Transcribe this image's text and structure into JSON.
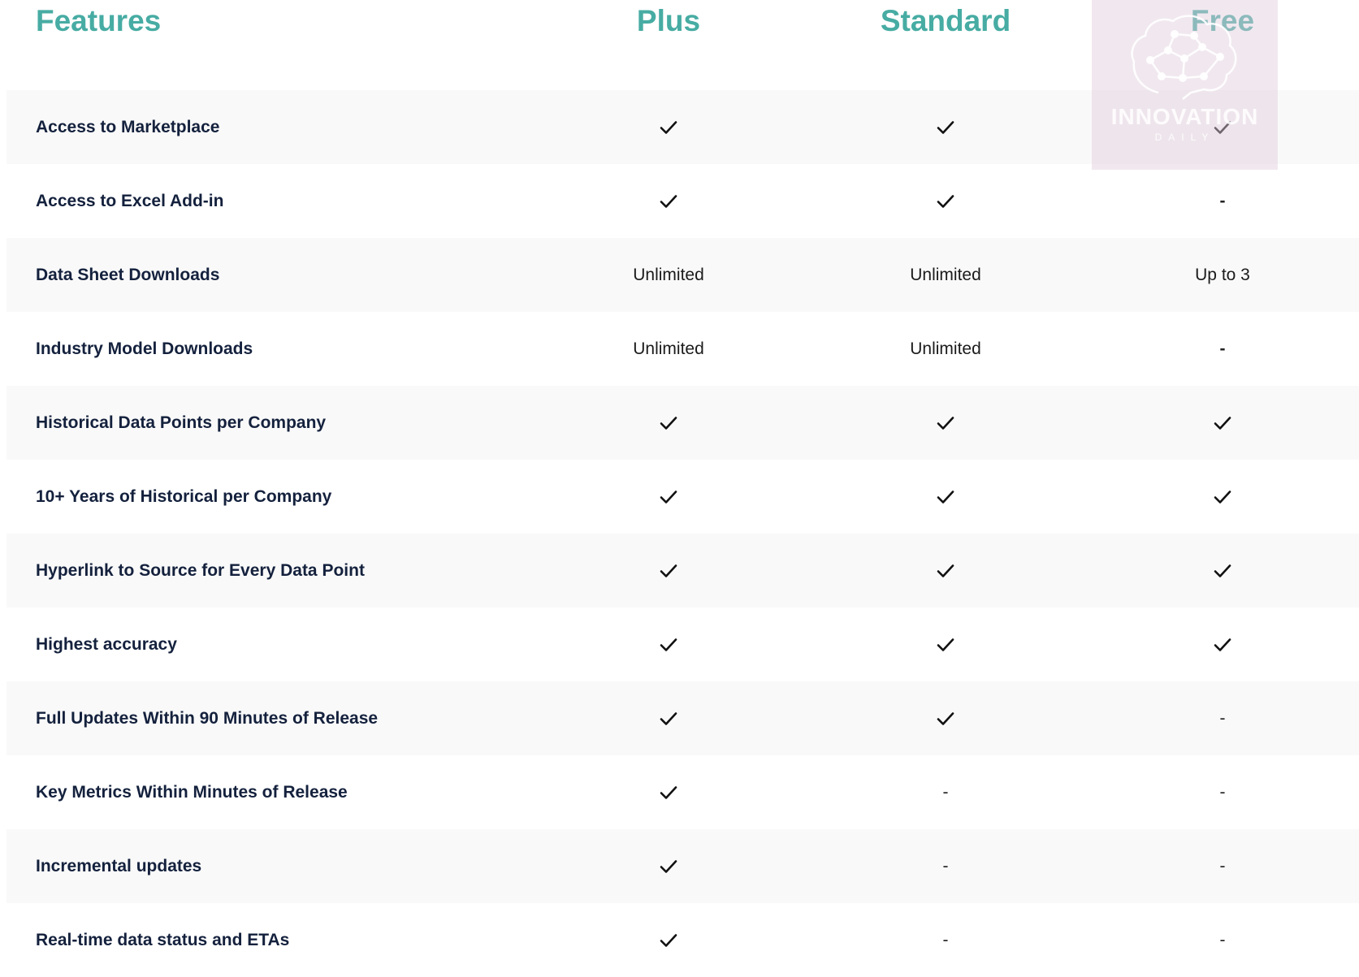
{
  "header": {
    "features_title": "Features",
    "plans": [
      "Plus",
      "Standard",
      "Free"
    ]
  },
  "rows": [
    {
      "feature": "Access to Marketplace",
      "plus": "check",
      "standard": "check",
      "free": "check"
    },
    {
      "feature": "Access to Excel Add-in",
      "plus": "check",
      "standard": "check",
      "free": "-"
    },
    {
      "feature": "Data Sheet Downloads",
      "plus": "Unlimited",
      "standard": "Unlimited",
      "free": "Up to 3"
    },
    {
      "feature": "Industry Model Downloads",
      "plus": "Unlimited",
      "standard": "Unlimited",
      "free": "-"
    },
    {
      "feature": "Historical Data Points per Company",
      "plus": "check",
      "standard": "check",
      "free": "check"
    },
    {
      "feature": "10+ Years of Historical per Company",
      "plus": "check",
      "standard": "check",
      "free": "check"
    },
    {
      "feature": "Hyperlink to Source for Every Data Point",
      "plus": "check",
      "standard": "check",
      "free": "check"
    },
    {
      "feature": "Highest accuracy",
      "plus": "check",
      "standard": "check",
      "free": "check"
    },
    {
      "feature": "Full Updates Within 90 Minutes of Release",
      "plus": "check",
      "standard": "check",
      "free": "-"
    },
    {
      "feature": "Key Metrics Within Minutes of Release",
      "plus": "check",
      "standard": "-",
      "free": "-"
    },
    {
      "feature": "Incremental updates",
      "plus": "check",
      "standard": "-",
      "free": "-"
    },
    {
      "feature": "Real-time data status and ETAs",
      "plus": "check",
      "standard": "-",
      "free": "-"
    }
  ],
  "watermark": {
    "title": "INNOVATION",
    "subtitle": "DAILY",
    "icon": "brain-network-icon"
  },
  "colors": {
    "accent": "#47aca3",
    "label": "#14213d",
    "shaded_row": "#f9f9f9"
  }
}
